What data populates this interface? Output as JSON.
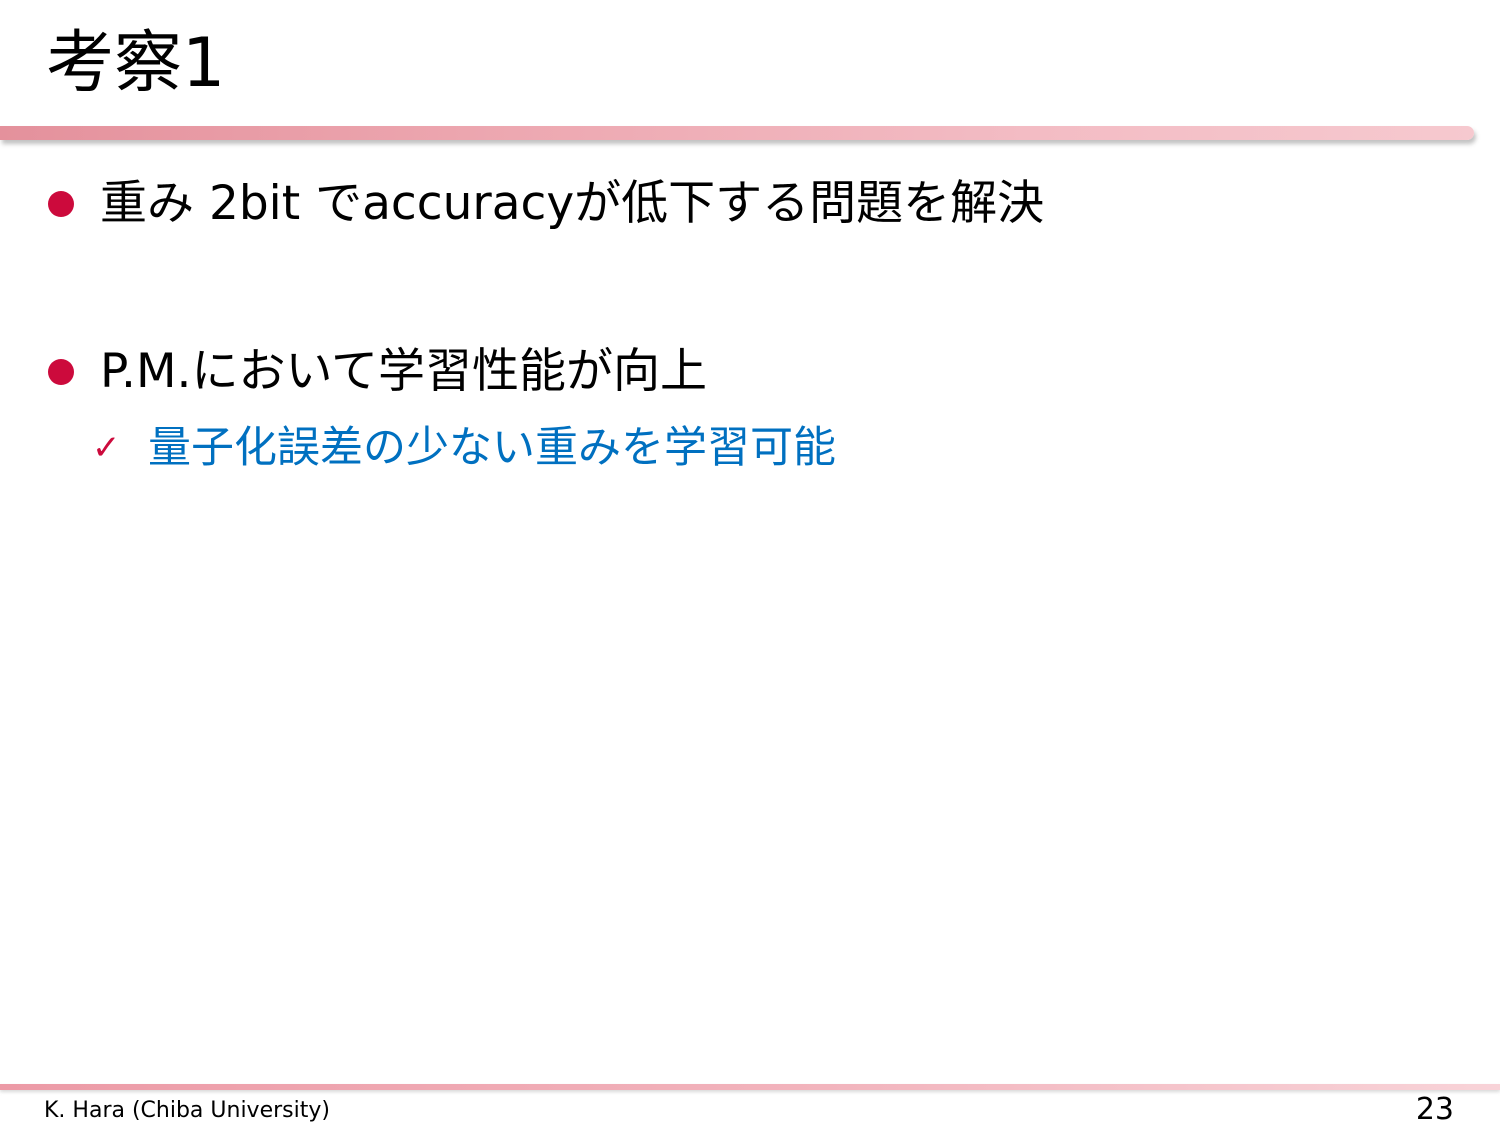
{
  "slide": {
    "title": "考察1",
    "bullets": [
      {
        "text": "重み 2bit でaccuracyが低下する問題を解決",
        "sub_items": []
      },
      {
        "text": "P.M.において学習性能が向上",
        "sub_items": [
          "量子化誤差の少ない重みを学習可能"
        ]
      }
    ],
    "check_symbol": "✓"
  },
  "footer": {
    "author": "K. Hara (Chiba University)",
    "page_number": "23"
  },
  "colors": {
    "bullet": "#cc0a3c",
    "sub_text": "#0070c0",
    "rule": "#eda8b1"
  }
}
